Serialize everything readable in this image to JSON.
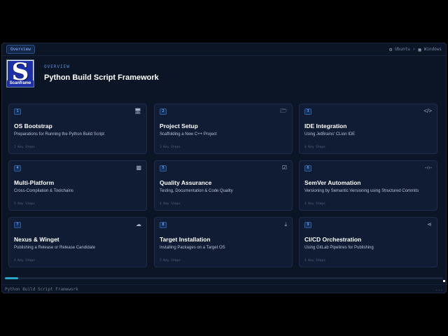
{
  "topbar": {
    "tab_label": "Overview",
    "os": [
      {
        "label": "Ubuntu",
        "icon": "linux-icon"
      },
      {
        "label": "Windows",
        "icon": "windows-icon"
      }
    ],
    "separator": ">"
  },
  "header": {
    "logo_letter": "S",
    "logo_word": "Scanframe",
    "eyebrow": "OVERVIEW",
    "title": "Python Build Script Framework"
  },
  "cards": [
    {
      "num": "1",
      "icon": "monitor-icon",
      "title": "OS Bootstrap",
      "subtitle": "Preparations for Running the Python Build Script",
      "steps": "2 Key Steps"
    },
    {
      "num": "2",
      "icon": "folder-plus-icon",
      "title": "Project Setup",
      "subtitle": "Scaffolding a New C++ Project",
      "steps": "3 Key Steps"
    },
    {
      "num": "3",
      "icon": "code-icon",
      "title": "IDE Integration",
      "subtitle": "Using JetBrains' CLion IDE",
      "steps": "4 Key Steps"
    },
    {
      "num": "4",
      "icon": "cubes-icon",
      "title": "Multi-Platform",
      "subtitle": "Cross-Compilation & Toolchains",
      "steps": "5 Key Steps"
    },
    {
      "num": "5",
      "icon": "clipboard-check-icon",
      "title": "Quality Assurance",
      "subtitle": "Testing, Documentation & Code Quality",
      "steps": "4 Key Steps"
    },
    {
      "num": "6",
      "icon": "commit-icon",
      "title": "SemVer Automation",
      "subtitle": "Versioning by Semantic Versioning using Structured Commits",
      "steps": "4 Key Steps"
    },
    {
      "num": "7",
      "icon": "cloud-upload-icon",
      "title": "Nexus & Winget",
      "subtitle": "Publishing a Release or Release Candidate",
      "steps": "4 Key Steps"
    },
    {
      "num": "8",
      "icon": "download-icon",
      "title": "Target Installation",
      "subtitle": "Installing Packages on a Target OS",
      "steps": "2 Key Steps"
    },
    {
      "num": "9",
      "icon": "pipeline-icon",
      "title": "CI/CD Orchestration",
      "subtitle": "Using GitLab Pipelines for Publishing",
      "steps": "4 Key Steps"
    }
  ],
  "progress": {
    "value": 0.03,
    "color": "#2aa6c8"
  },
  "footer": {
    "left": "Python Build Script Framework",
    "right": "..."
  }
}
